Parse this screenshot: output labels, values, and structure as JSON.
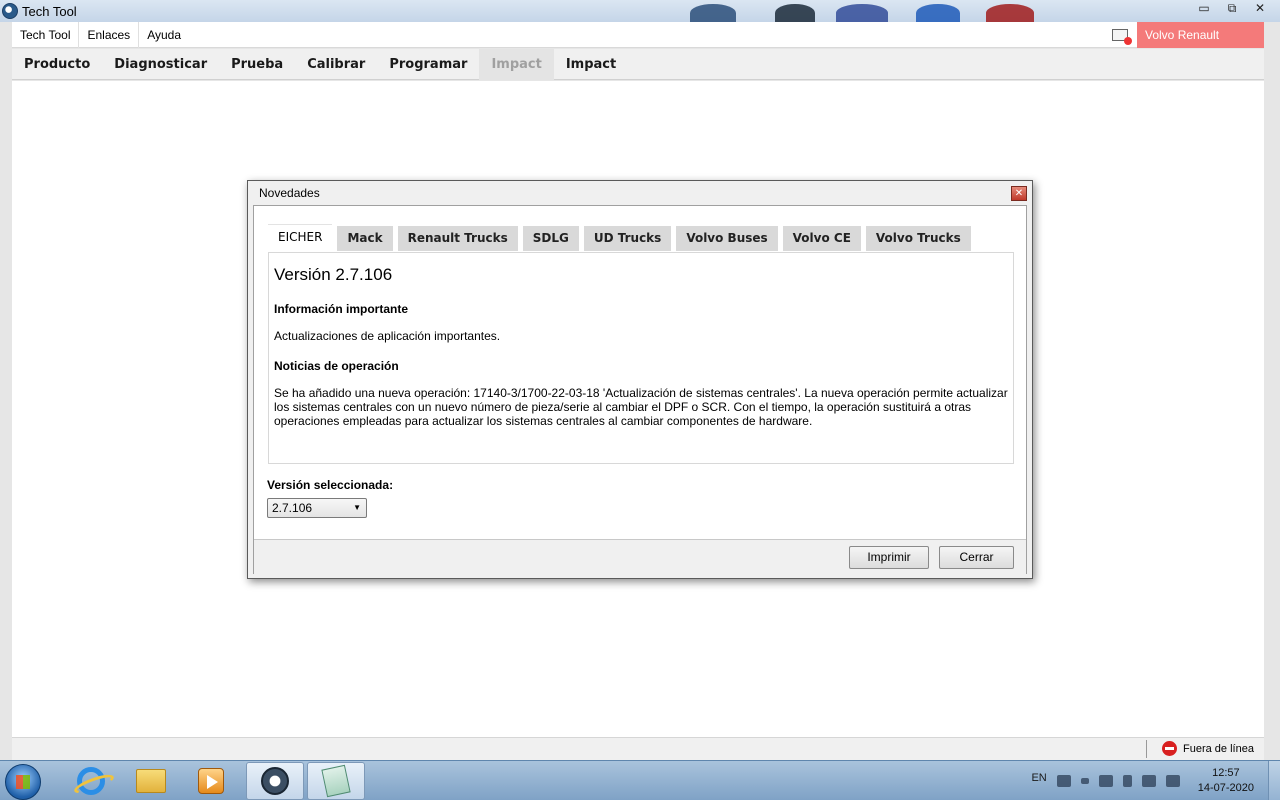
{
  "window": {
    "title": "Tech Tool",
    "controls": {
      "minimize": "▭",
      "restore": "⧉",
      "close": "✕"
    }
  },
  "menubar": {
    "items": [
      "Tech Tool",
      "Enlaces",
      "Ayuda"
    ],
    "brand_badge": "Volvo Renault Trucks",
    "brand_color": "#f47a7a"
  },
  "navbar": {
    "items": [
      "Producto",
      "Diagnosticar",
      "Prueba",
      "Calibrar",
      "Programar",
      "Impact",
      "Impact"
    ]
  },
  "status": {
    "offline_label": "Fuera de línea",
    "offline_icon": "offline-icon"
  },
  "dialog": {
    "title": "Novedades",
    "close_label": "✕",
    "tabs": [
      "EICHER",
      "Mack",
      "Renault Trucks",
      "SDLG",
      "UD Trucks",
      "Volvo Buses",
      "Volvo CE",
      "Volvo Trucks"
    ],
    "active_tab": "EICHER",
    "content": {
      "version": "Versión 2.7.106",
      "heading_important": "Información importante",
      "important_text": "Actualizaciones de aplicación importantes.",
      "heading_operation": "Noticias de operación",
      "operation_text": "Se ha añadido una nueva operación: 17140-3/1700-22-03-18 'Actualización de sistemas centrales'. La nueva operación permite actualizar los sistemas centrales con un nuevo número de pieza/serie al cambiar el DPF o SCR. Con el tiempo, la operación sustituirá a otras operaciones empleadas para actualizar los sistemas centrales al cambiar componentes de hardware."
    },
    "selected_version_label": "Versión seleccionada:",
    "selected_version_value": "2.7.106",
    "print_button": "Imprimir",
    "close_button": "Cerrar"
  },
  "taskbar": {
    "apps": [
      "internet-explorer-icon",
      "folder-icon",
      "media-player-icon",
      "tech-tool-icon",
      "notepad-icon"
    ],
    "tray_language": "EN",
    "clock_time": "12:57",
    "clock_date": "14-07-2020"
  }
}
